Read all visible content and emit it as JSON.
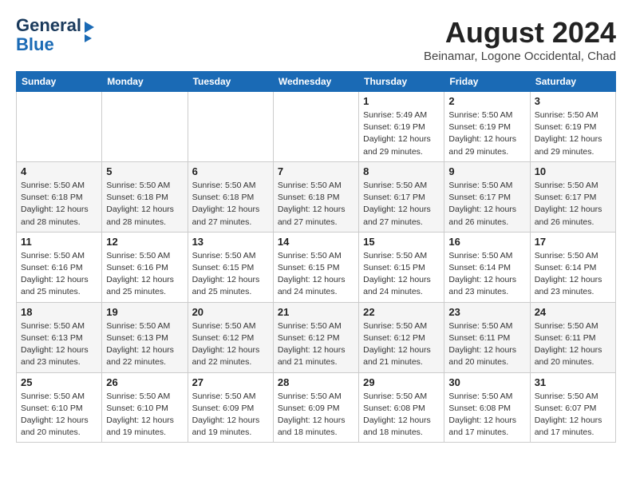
{
  "header": {
    "logo_line1": "General",
    "logo_line2": "Blue",
    "month_year": "August 2024",
    "location": "Beinamar, Logone Occidental, Chad"
  },
  "weekdays": [
    "Sunday",
    "Monday",
    "Tuesday",
    "Wednesday",
    "Thursday",
    "Friday",
    "Saturday"
  ],
  "weeks": [
    [
      {
        "day": "",
        "info": ""
      },
      {
        "day": "",
        "info": ""
      },
      {
        "day": "",
        "info": ""
      },
      {
        "day": "",
        "info": ""
      },
      {
        "day": "1",
        "info": "Sunrise: 5:49 AM\nSunset: 6:19 PM\nDaylight: 12 hours\nand 29 minutes."
      },
      {
        "day": "2",
        "info": "Sunrise: 5:50 AM\nSunset: 6:19 PM\nDaylight: 12 hours\nand 29 minutes."
      },
      {
        "day": "3",
        "info": "Sunrise: 5:50 AM\nSunset: 6:19 PM\nDaylight: 12 hours\nand 29 minutes."
      }
    ],
    [
      {
        "day": "4",
        "info": "Sunrise: 5:50 AM\nSunset: 6:18 PM\nDaylight: 12 hours\nand 28 minutes."
      },
      {
        "day": "5",
        "info": "Sunrise: 5:50 AM\nSunset: 6:18 PM\nDaylight: 12 hours\nand 28 minutes."
      },
      {
        "day": "6",
        "info": "Sunrise: 5:50 AM\nSunset: 6:18 PM\nDaylight: 12 hours\nand 27 minutes."
      },
      {
        "day": "7",
        "info": "Sunrise: 5:50 AM\nSunset: 6:18 PM\nDaylight: 12 hours\nand 27 minutes."
      },
      {
        "day": "8",
        "info": "Sunrise: 5:50 AM\nSunset: 6:17 PM\nDaylight: 12 hours\nand 27 minutes."
      },
      {
        "day": "9",
        "info": "Sunrise: 5:50 AM\nSunset: 6:17 PM\nDaylight: 12 hours\nand 26 minutes."
      },
      {
        "day": "10",
        "info": "Sunrise: 5:50 AM\nSunset: 6:17 PM\nDaylight: 12 hours\nand 26 minutes."
      }
    ],
    [
      {
        "day": "11",
        "info": "Sunrise: 5:50 AM\nSunset: 6:16 PM\nDaylight: 12 hours\nand 25 minutes."
      },
      {
        "day": "12",
        "info": "Sunrise: 5:50 AM\nSunset: 6:16 PM\nDaylight: 12 hours\nand 25 minutes."
      },
      {
        "day": "13",
        "info": "Sunrise: 5:50 AM\nSunset: 6:15 PM\nDaylight: 12 hours\nand 25 minutes."
      },
      {
        "day": "14",
        "info": "Sunrise: 5:50 AM\nSunset: 6:15 PM\nDaylight: 12 hours\nand 24 minutes."
      },
      {
        "day": "15",
        "info": "Sunrise: 5:50 AM\nSunset: 6:15 PM\nDaylight: 12 hours\nand 24 minutes."
      },
      {
        "day": "16",
        "info": "Sunrise: 5:50 AM\nSunset: 6:14 PM\nDaylight: 12 hours\nand 23 minutes."
      },
      {
        "day": "17",
        "info": "Sunrise: 5:50 AM\nSunset: 6:14 PM\nDaylight: 12 hours\nand 23 minutes."
      }
    ],
    [
      {
        "day": "18",
        "info": "Sunrise: 5:50 AM\nSunset: 6:13 PM\nDaylight: 12 hours\nand 23 minutes."
      },
      {
        "day": "19",
        "info": "Sunrise: 5:50 AM\nSunset: 6:13 PM\nDaylight: 12 hours\nand 22 minutes."
      },
      {
        "day": "20",
        "info": "Sunrise: 5:50 AM\nSunset: 6:12 PM\nDaylight: 12 hours\nand 22 minutes."
      },
      {
        "day": "21",
        "info": "Sunrise: 5:50 AM\nSunset: 6:12 PM\nDaylight: 12 hours\nand 21 minutes."
      },
      {
        "day": "22",
        "info": "Sunrise: 5:50 AM\nSunset: 6:12 PM\nDaylight: 12 hours\nand 21 minutes."
      },
      {
        "day": "23",
        "info": "Sunrise: 5:50 AM\nSunset: 6:11 PM\nDaylight: 12 hours\nand 20 minutes."
      },
      {
        "day": "24",
        "info": "Sunrise: 5:50 AM\nSunset: 6:11 PM\nDaylight: 12 hours\nand 20 minutes."
      }
    ],
    [
      {
        "day": "25",
        "info": "Sunrise: 5:50 AM\nSunset: 6:10 PM\nDaylight: 12 hours\nand 20 minutes."
      },
      {
        "day": "26",
        "info": "Sunrise: 5:50 AM\nSunset: 6:10 PM\nDaylight: 12 hours\nand 19 minutes."
      },
      {
        "day": "27",
        "info": "Sunrise: 5:50 AM\nSunset: 6:09 PM\nDaylight: 12 hours\nand 19 minutes."
      },
      {
        "day": "28",
        "info": "Sunrise: 5:50 AM\nSunset: 6:09 PM\nDaylight: 12 hours\nand 18 minutes."
      },
      {
        "day": "29",
        "info": "Sunrise: 5:50 AM\nSunset: 6:08 PM\nDaylight: 12 hours\nand 18 minutes."
      },
      {
        "day": "30",
        "info": "Sunrise: 5:50 AM\nSunset: 6:08 PM\nDaylight: 12 hours\nand 17 minutes."
      },
      {
        "day": "31",
        "info": "Sunrise: 5:50 AM\nSunset: 6:07 PM\nDaylight: 12 hours\nand 17 minutes."
      }
    ]
  ]
}
